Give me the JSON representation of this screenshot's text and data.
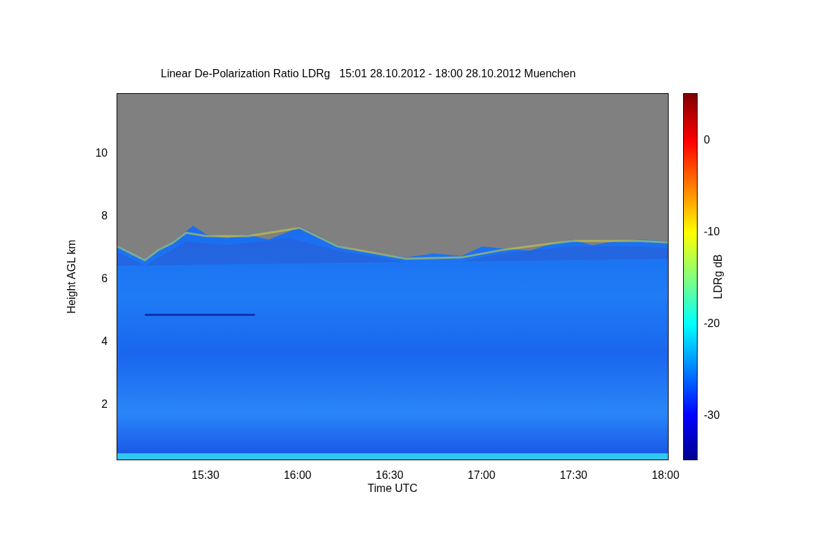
{
  "figure": {
    "title": "Linear De-Polarization Ratio LDRg   15:01 28.10.2012 - 18:00 28.10.2012 Muenchen",
    "ylabel": "Height AGL km",
    "xlabel": "Time UTC",
    "yticks": [
      "10",
      "8",
      "6",
      "4",
      "2"
    ],
    "xticks": [
      "15:30",
      "16:00",
      "16:30",
      "17:00",
      "17:30",
      "18:00"
    ],
    "colorbar": {
      "label": "LDRg dB",
      "ticks": [
        "0",
        "-10",
        "-20",
        "-30"
      ]
    }
  }
}
